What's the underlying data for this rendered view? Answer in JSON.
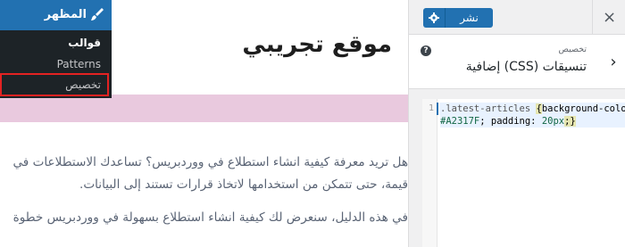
{
  "wp_menu": {
    "header_label": "المظهر",
    "items": [
      {
        "label": "قوالب",
        "current": true
      },
      {
        "label": "Patterns",
        "current": false
      },
      {
        "label": "تخصيص",
        "current": false
      }
    ]
  },
  "preview": {
    "site_title": "موقع تجريبي",
    "paragraph1_line1": "هل تريد معرفة كيفية انشاء استطلاع في ووردبريس؟ تساعدك الاستطلاعات في",
    "paragraph1_line2": "قيمة، حتى تتمكن من استخدامها لاتخاذ قرارات تستند إلى البيانات.",
    "paragraph2_line1": "في هذه الدليل، سنعرض لك كيفية انشاء استطلاع بسهولة في ووردبريس خطوة"
  },
  "panel": {
    "close_icon": "×",
    "publish_label": "نشر",
    "section_sub": "تخصيص",
    "section_title": "تنسيقات (CSS) إضافية",
    "help_icon": "?",
    "back_icon": "›"
  },
  "editor": {
    "line_number": "1",
    "selector": ".latest-articles",
    "open_brace": "{",
    "prop1": "background-color:",
    "val1": "#A2317F",
    "prop2": "; padding:",
    "val2": "20px",
    "close": ";}"
  },
  "colors": {
    "accent": "#2271b1",
    "menu_bg": "#1d2327",
    "highlight_border": "#e32222",
    "pink_band": "#e9c9de"
  }
}
